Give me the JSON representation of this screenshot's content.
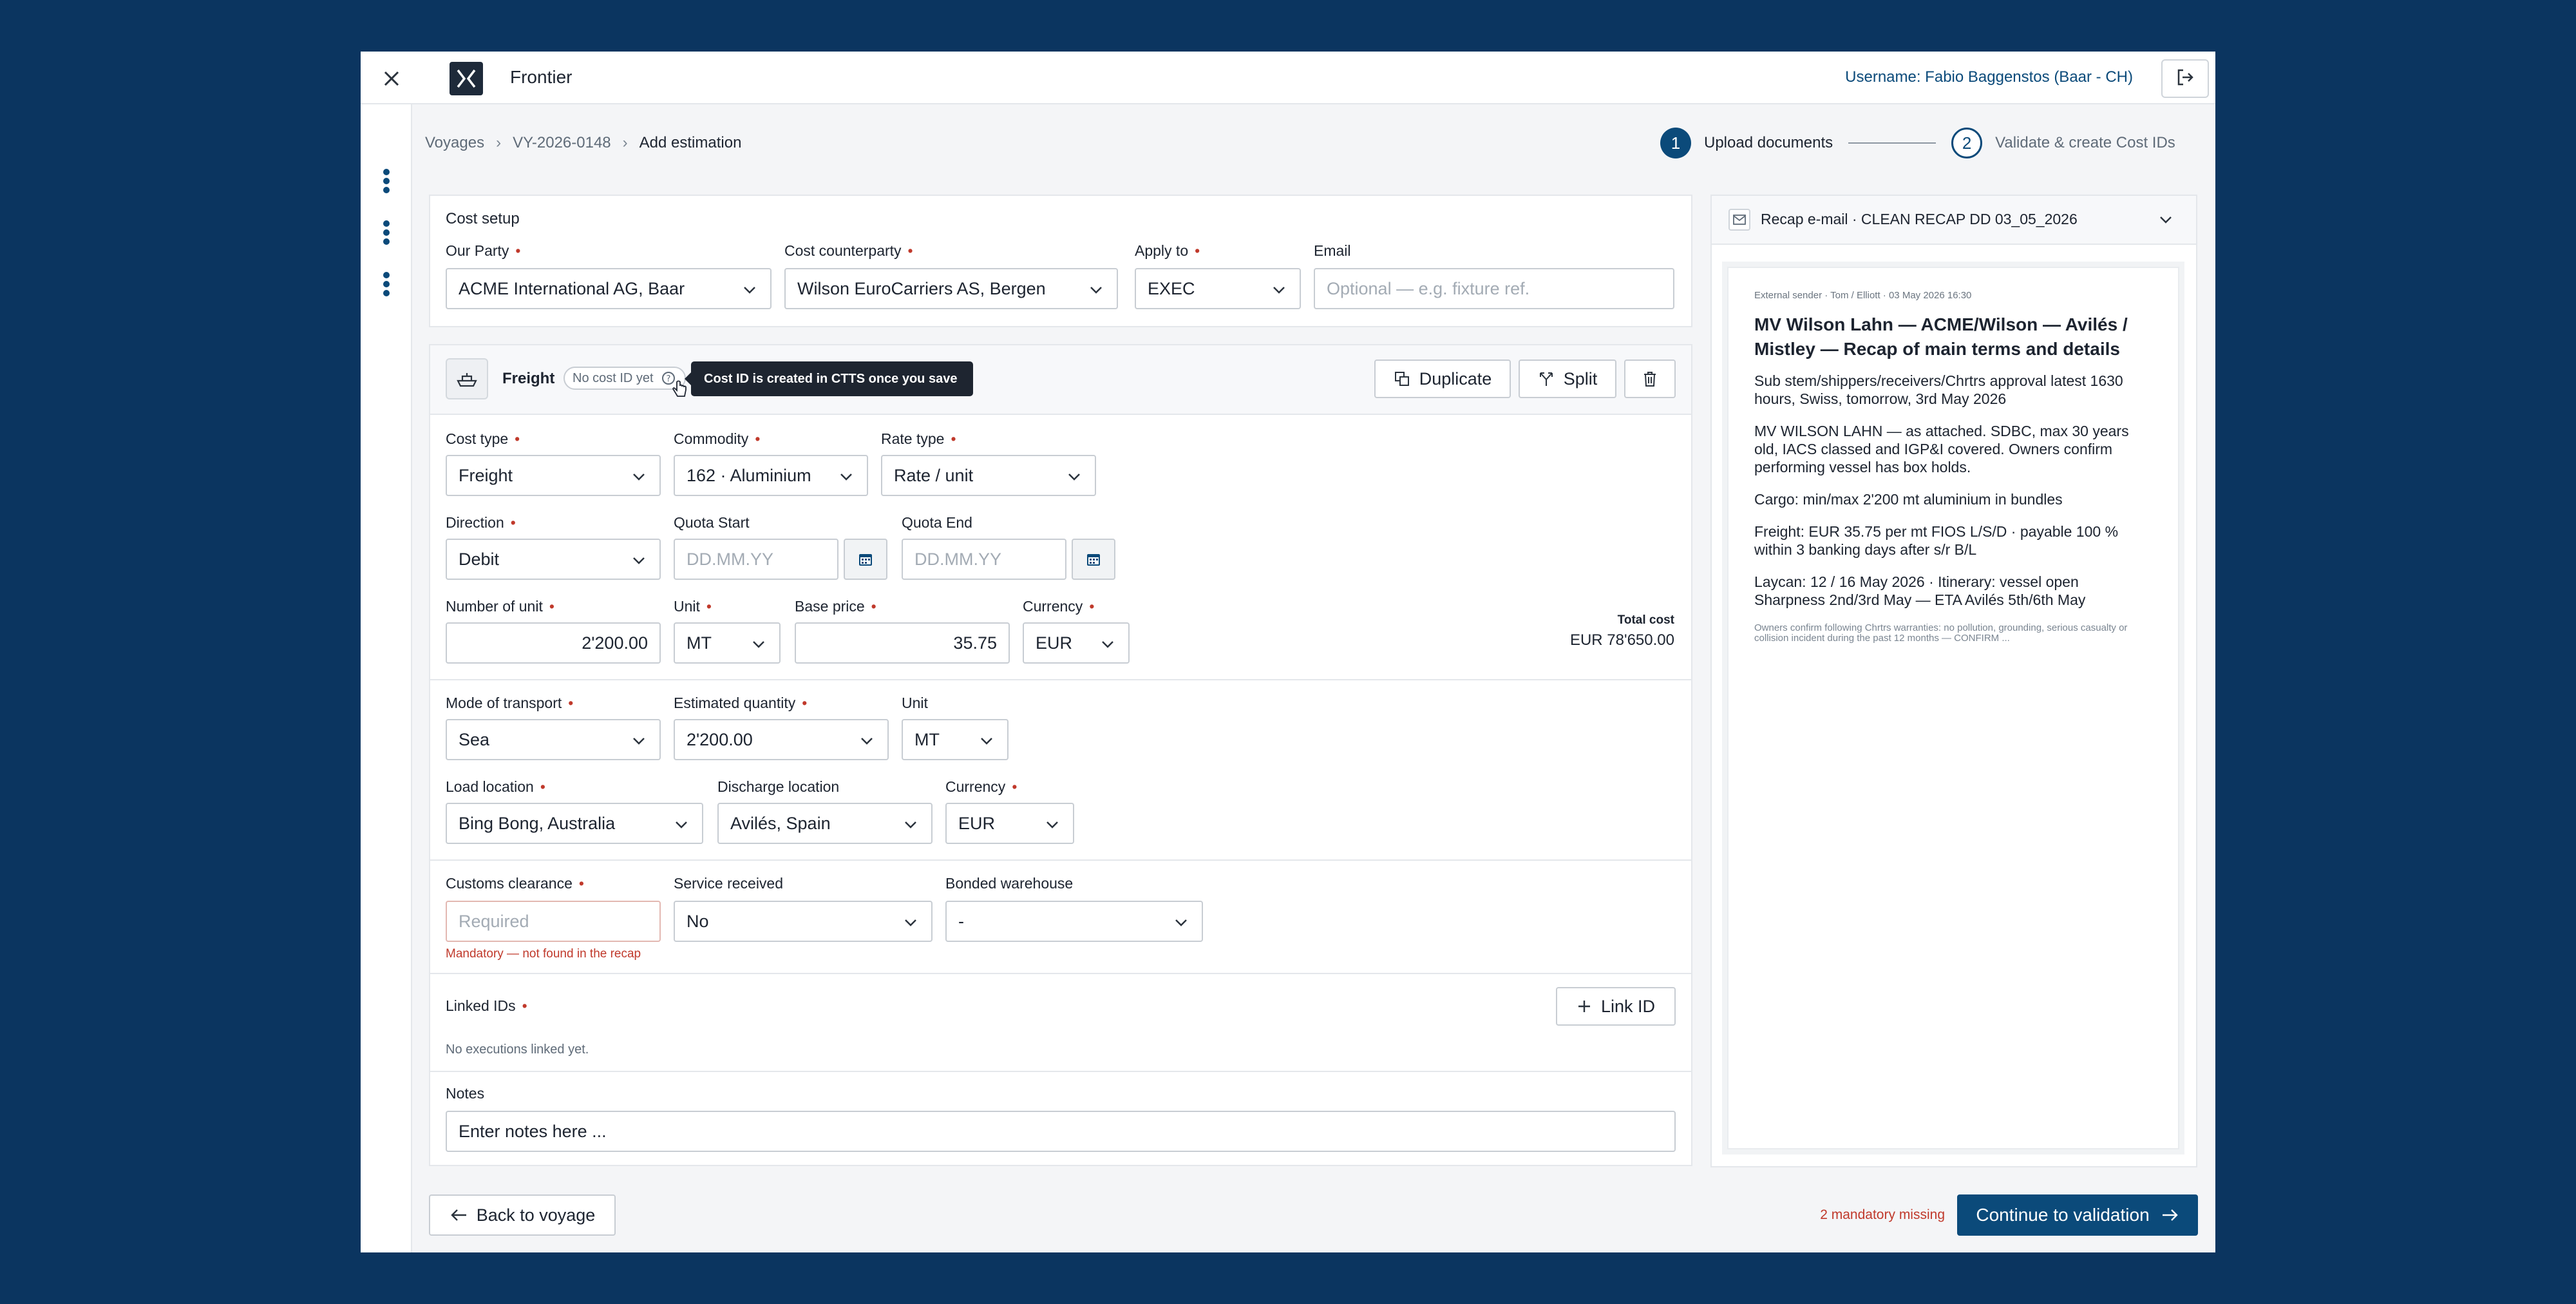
{
  "app": {
    "title": "Frontier",
    "username": "Username: Fabio Baggenstos (Baar - CH)"
  },
  "breadcrumb": [
    "Voyages",
    "VY-2026-0148",
    "Add estimation"
  ],
  "stepper": [
    {
      "num": "1",
      "label": "Upload documents",
      "active": true
    },
    {
      "num": "2",
      "label": "Validate & create Cost IDs",
      "active": false
    }
  ],
  "cost_setup": {
    "title": "Cost setup",
    "our_party": {
      "label": "Our Party",
      "value": "ACME International AG, Baar"
    },
    "counterparty": {
      "label": "Cost counterparty",
      "value": "Wilson EuroCarriers AS, Bergen"
    },
    "apply_to": {
      "label": "Apply to",
      "value": "EXEC"
    },
    "email": {
      "label": "Email",
      "placeholder": "Optional — e.g. fixture ref."
    }
  },
  "freight": {
    "title": "Freight",
    "badge": "No cost ID yet",
    "tooltip": "Cost ID is created in CTTS once you save",
    "duplicate_label": "Duplicate",
    "split_label": "Split",
    "cost_type": {
      "label": "Cost type",
      "value": "Freight"
    },
    "commodity": {
      "label": "Commodity",
      "value": "162 · Aluminium"
    },
    "rate_type": {
      "label": "Rate type",
      "value": "Rate / unit"
    },
    "direction": {
      "label": "Direction",
      "value": "Debit"
    },
    "quota_start": {
      "label": "Quota Start",
      "placeholder": "DD.MM.YY"
    },
    "quota_end": {
      "label": "Quota End",
      "placeholder": "DD.MM.YY"
    },
    "number_of_unit": {
      "label": "Number of unit",
      "value": "2'200.00"
    },
    "unit": {
      "label": "Unit",
      "value": "MT"
    },
    "base_price": {
      "label": "Base price",
      "value": "35.75"
    },
    "currency": {
      "label": "Currency",
      "value": "EUR"
    },
    "total_cost": {
      "label": "Total cost",
      "value": "EUR 78'650.00"
    },
    "mode_of_transport": {
      "label": "Mode of transport",
      "value": "Sea"
    },
    "estimated_quantity": {
      "label": "Estimated quantity",
      "value": "2'200.00"
    },
    "unit2": {
      "label": "Unit",
      "value": "MT"
    },
    "load_location": {
      "label": "Load location",
      "value": "Bing Bong, Australia"
    },
    "discharge_location": {
      "label": "Discharge location",
      "value": "Avilés, Spain"
    },
    "currency2": {
      "label": "Currency",
      "value": "EUR"
    },
    "customs_clearance": {
      "label": "Customs clearance",
      "placeholder": "Required",
      "error": "Mandatory — not found in the recap"
    },
    "service_received": {
      "label": "Service received",
      "value": "No"
    },
    "bonded_warehouse": {
      "label": "Bonded warehouse",
      "value": "-"
    },
    "linked_ids": {
      "label": "Linked IDs",
      "button": "Link ID",
      "empty": "No executions linked yet."
    },
    "notes": {
      "label": "Notes",
      "placeholder": "Enter notes here ..."
    }
  },
  "recap": {
    "header": "Recap e-mail · CLEAN RECAP DD 03_05_2026",
    "meta": "External sender · Tom / Elliott · 03 May 2026 16:30",
    "title": "MV Wilson Lahn — ACME/Wilson — Avilés / Mistley — Recap of main terms and details",
    "paragraphs": [
      "Sub stem/shippers/receivers/Chrtrs approval latest 1630 hours, Swiss, tomorrow, 3rd May 2026",
      "MV WILSON LAHN — as attached. SDBC, max 30 years old, IACS classed and IGP&I covered. Owners confirm performing vessel has box holds.",
      "Cargo: min/max 2'200 mt aluminium in bundles",
      "Freight: EUR 35.75 per mt FIOS L/S/D · payable 100 % within 3 banking days after s/r B/L",
      "Laycan: 12 / 16 May 2026 · Itinerary: vessel open Sharpness 2nd/3rd May — ETA Avilés 5th/6th May"
    ],
    "fine_print": "Owners confirm following Chrtrs warranties: no pollution, grounding, serious casualty or collision incident during the past 12 months — CONFIRM ..."
  },
  "footer": {
    "back_label": "Back to voyage",
    "missing": "2 mandatory missing",
    "continue_label": "Continue to validation"
  },
  "colors": {
    "background": "#0b3560",
    "primary": "#0b4a7a",
    "error": "#c0392b"
  }
}
